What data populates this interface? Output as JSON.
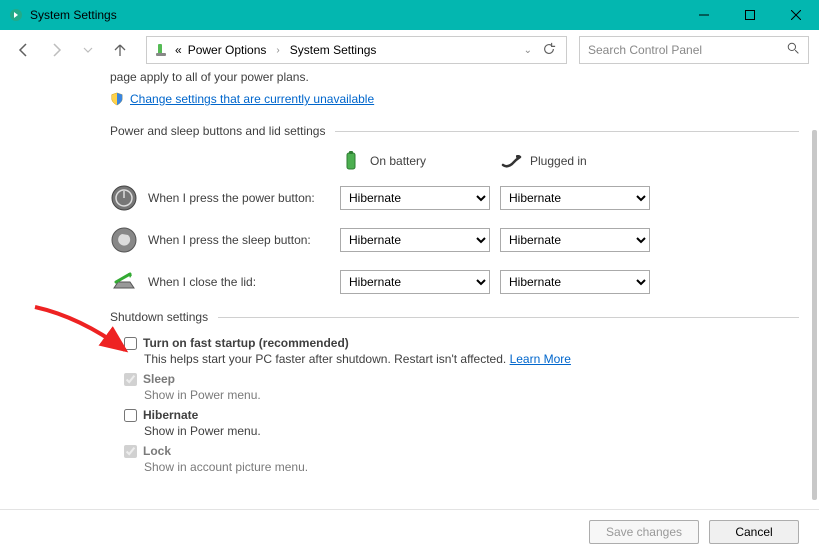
{
  "window": {
    "title": "System Settings"
  },
  "breadcrumb": {
    "prefix": "«",
    "items": [
      "Power Options",
      "System Settings"
    ]
  },
  "search": {
    "placeholder": "Search Control Panel"
  },
  "truncated_top": "page apply to all of your power plans.",
  "change_link": "Change settings that are currently unavailable",
  "section1_title": "Power and sleep buttons and lid settings",
  "col_battery": "On battery",
  "col_plugged": "Plugged in",
  "rows": [
    {
      "label": "When I press the power button:",
      "battery": "Hibernate",
      "plugged": "Hibernate"
    },
    {
      "label": "When I press the sleep button:",
      "battery": "Hibernate",
      "plugged": "Hibernate"
    },
    {
      "label": "When I close the lid:",
      "battery": "Hibernate",
      "plugged": "Hibernate"
    }
  ],
  "section2_title": "Shutdown settings",
  "shutdown": {
    "fast": {
      "label": "Turn on fast startup (recommended)",
      "desc": "This helps start your PC faster after shutdown. Restart isn't affected. ",
      "learn": "Learn More"
    },
    "sleep": {
      "label": "Sleep",
      "desc": "Show in Power menu."
    },
    "hibernate": {
      "label": "Hibernate",
      "desc": "Show in Power menu."
    },
    "lock": {
      "label": "Lock",
      "desc": "Show in account picture menu."
    }
  },
  "footer": {
    "save": "Save changes",
    "cancel": "Cancel"
  }
}
